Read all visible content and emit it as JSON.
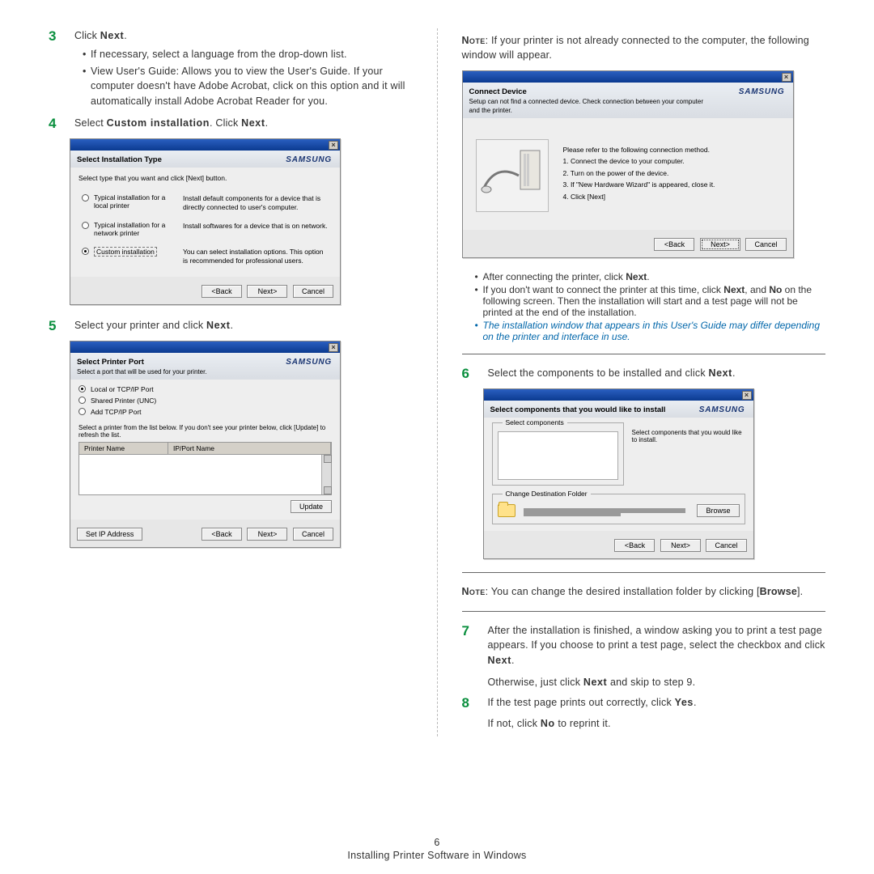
{
  "footer": {
    "page": "6",
    "text": "Installing Printer Software in Windows"
  },
  "left": {
    "step3": {
      "num": "3",
      "lead": "Click ",
      "action": "Next",
      "tail": ".",
      "bullets": [
        "If necessary, select a language from the drop-down list.",
        "View User's Guide: Allows you to view the User's Guide. If your computer doesn't have Adobe Acrobat, click on this option and it will automatically install Adobe Acrobat Reader for you."
      ]
    },
    "step4": {
      "num": "4",
      "lead": "Select ",
      "mid": "Custom installation",
      "tail": ". Click ",
      "action": "Next",
      "end": "."
    },
    "win4": {
      "title": "Select Installation Type",
      "sub": "Select type that you want and click [Next] button.",
      "brand": "SAMSUNG",
      "options": [
        {
          "label": "Typical installation for a local printer",
          "desc": "Install default components for a device that is directly connected to user's computer.",
          "selected": false
        },
        {
          "label": "Typical installation for a network printer",
          "desc": "Install softwares for a device that is on network.",
          "selected": false
        },
        {
          "label": "Custom installation",
          "desc": "You can select installation options. This option is recommended for professional users.",
          "selected": true,
          "boxed": true
        }
      ],
      "btn_back": "<Back",
      "btn_next": "Next>",
      "btn_cancel": "Cancel"
    },
    "step5": {
      "num": "5",
      "text": "Select your printer and click ",
      "action": "Next",
      "tail": "."
    },
    "win5": {
      "title": "Select Printer Port",
      "sub": "Select a port that will be used for your printer.",
      "brand": "SAMSUNG",
      "radios": [
        {
          "label": "Local or TCP/IP Port",
          "selected": true
        },
        {
          "label": "Shared Printer (UNC)",
          "selected": false
        },
        {
          "label": "Add TCP/IP Port",
          "selected": false
        }
      ],
      "hint": "Select a printer from the list below. If you don't see your printer below, click [Update] to refresh the list.",
      "col1": "Printer Name",
      "col2": "IP/Port Name",
      "btn_update": "Update",
      "btn_setip": "Set IP Address",
      "btn_back": "<Back",
      "btn_next": "Next>",
      "btn_cancel": "Cancel"
    }
  },
  "right": {
    "note1": {
      "sc": "Note",
      "text": ": If your printer is not already connected to the computer, the following window will appear."
    },
    "winConn": {
      "title": "Connect Device",
      "sub": "Setup can not find a connected device. Check connection between your computer and the printer.",
      "brand": "SAMSUNG",
      "intro": "Please refer to the following connection method.",
      "steps": [
        "1. Connect the device to your computer.",
        "2. Turn on the power of the device.",
        "3. If \"New Hardware Wizard\" is appeared, close it.",
        "4. Click [Next]"
      ],
      "btn_back": "<Back",
      "btn_next": "Next>",
      "btn_cancel": "Cancel"
    },
    "afterConn": {
      "b1_pre": "After connecting the printer, click ",
      "b1_action": "Next",
      "b1_post": ".",
      "b2_pre": "If you don't want to connect the printer at this time, click ",
      "b2_a1": "Next",
      "b2_mid": ", and ",
      "b2_a2": "No",
      "b2_post": " on the following screen. Then the installation will start and a test page will not be printed at the end of the installation.",
      "b3": "The installation window that appears in this User's Guide may differ depending on the printer and interface in use."
    },
    "step6": {
      "num": "6",
      "text": "Select the components to be installed and click ",
      "action": "Next",
      "tail": "."
    },
    "win6": {
      "title": "Select components that you would like to install",
      "brand": "SAMSUNG",
      "group": "Select components",
      "sidehelp": "Select components that you would like to install.",
      "dest": "Change Destination Folder",
      "btn_browse": "Browse",
      "btn_back": "<Back",
      "btn_next": "Next>",
      "btn_cancel": "Cancel"
    },
    "note2": {
      "sc": "Note",
      "mid": ": You can change the desired installation folder by clicking [",
      "btn": "Browse",
      "post": "]."
    },
    "step7": {
      "num": "7",
      "text": "After the installation is finished, a window asking you to print a test page appears. If you choose to print a test page, select the checkbox and click ",
      "action": "Next",
      "tail": ".",
      "extra_pre": "Otherwise, just click ",
      "extra_action": "Next",
      "extra_post": " and skip to step 9."
    },
    "step8": {
      "num": "8",
      "pre": "If the test page prints out correctly, click ",
      "a1": "Yes",
      "mid": ".",
      "extra_pre": "If not, click ",
      "a2": "No",
      "extra_post": " to reprint it."
    }
  }
}
